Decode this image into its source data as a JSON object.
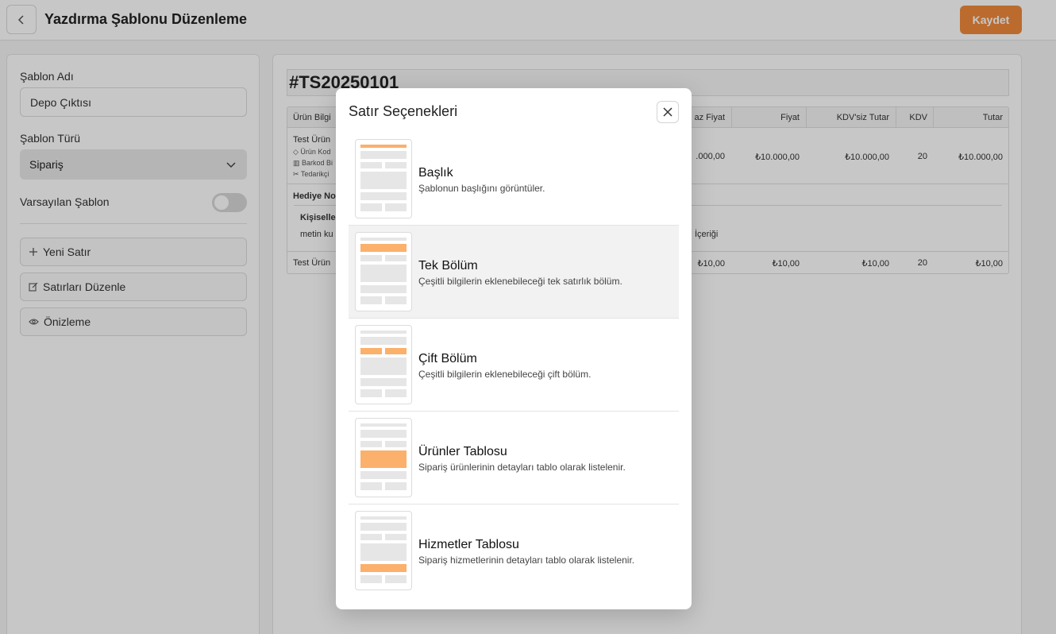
{
  "header": {
    "title": "Yazdırma Şablonu Düzenleme",
    "save_label": "Kaydet"
  },
  "form": {
    "template_name_label": "Şablon Adı",
    "template_name_value": "Depo Çıktısı",
    "template_type_label": "Şablon Türü",
    "template_type_value": "Sipariş",
    "default_label": "Varsayılan Şablon",
    "default_on": false
  },
  "actions": {
    "new_row": "Yeni Satır",
    "edit_rows": "Satırları Düzenle",
    "preview": "Önizleme"
  },
  "preview": {
    "doc_number": "#TS20250101",
    "table": {
      "columns": [
        "Ürün Bilgi",
        "az Fiyat",
        "Fiyat",
        "KDV'siz Tutar",
        "KDV",
        "Tutar"
      ],
      "row1": {
        "name": "Test Ürün",
        "sub1": "Ürün Kod",
        "sub2": "Barkod Bi",
        "sub3": "Tedarikçi",
        "cells": [
          ".000,00",
          "₺10.000,00",
          "₺10.000,00",
          "20",
          "₺10.000,00"
        ]
      },
      "gift_label": "Hediye No",
      "personal_label": "Kişiselle",
      "personal_text": "metin ku",
      "content_text": "İçeriği",
      "row2": {
        "name": "Test Ürün",
        "cells": [
          "₺10,00",
          "₺10,00",
          "₺10,00",
          "20",
          "₺10,00"
        ]
      }
    }
  },
  "modal": {
    "title": "Satır Seçenekleri",
    "options": [
      {
        "title": "Başlık",
        "desc": "Şablonun başlığını görüntüler."
      },
      {
        "title": "Tek Bölüm",
        "desc": "Çeşitli bilgilerin eklenebileceği tek satırlık bölüm."
      },
      {
        "title": "Çift Bölüm",
        "desc": "Çeşitli bilgilerin eklenebileceği çift bölüm."
      },
      {
        "title": "Ürünler Tablosu",
        "desc": "Sipariş ürünlerinin detayları tablo olarak listelenir."
      },
      {
        "title": "Hizmetler Tablosu",
        "desc": "Sipariş hizmetlerinin detayları tablo olarak listelenir."
      }
    ]
  },
  "colors": {
    "accent": "#f08a3c",
    "highlight": "#fbb06b"
  },
  "icons": [
    "chevron-left-icon",
    "chevron-down-icon",
    "plus-icon",
    "edit-icon",
    "eye-icon",
    "close-icon"
  ]
}
